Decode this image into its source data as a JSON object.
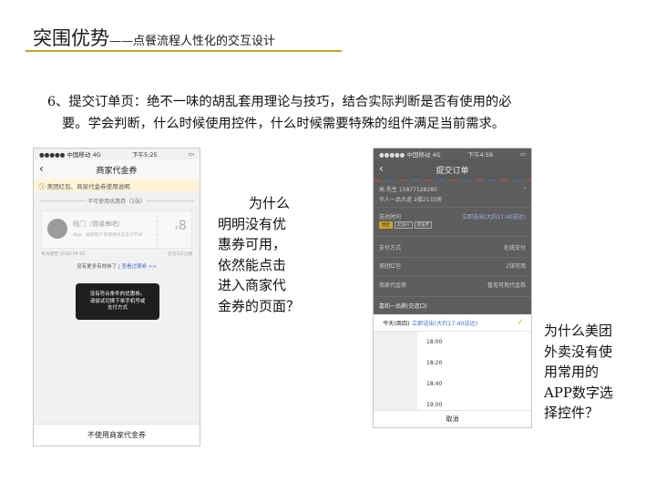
{
  "slide": {
    "title_main": "突围优势",
    "title_sub": "——点餐流程人性化的交互设计",
    "accent_color": "#c9a227",
    "paragraph_line1": "6、提交订单页：绝不一味的胡乱套用理论与技巧，结合实际判断是否有使用的必",
    "paragraph_line2": "要。学会判断，什么时候使用控件，什么时候需要特殊的组件满足当前需求。"
  },
  "phone1": {
    "status_left": "●●●●● 中国移动  4G",
    "status_time": "下午5:25",
    "status_right": "▭",
    "back_icon": "chevron-left-icon",
    "nav_title": "商家代金券",
    "notice": "ⓘ 美团红包、商家代金券使用说明",
    "section_header": "不可使用优惠券（1张）",
    "coupon": {
      "name": "贱门（情缘串吧）",
      "desc": "App、编辑现下单使用点击支付节单",
      "currency": "¥",
      "amount": "8",
      "date_left": "有效期至 2016-04-02",
      "date_right": "还有1天过期"
    },
    "no_more_text": "没有更多有效券了",
    "no_more_link": "查看过期券 >>",
    "toast_line1": "没有符合条件的优惠券。",
    "toast_line2": "请尝试切换下单手机号或",
    "toast_line3": "支付方式",
    "bottom_button": "不使用商家代金券"
  },
  "phone2": {
    "status_left": "●●●●● 中国移动  4G",
    "status_time": "下午4:58",
    "nav_title": "提交订单",
    "address_name": "高 先生     15877128280",
    "address_line": "华人一品大道 2楼2133房",
    "delivery_label": "送达时间",
    "delivery_value": "立即送出(大约17:40送达)",
    "tag1": "预定",
    "tag2": "起送价",
    "tag3": "配送费",
    "pay_label": "支付方式",
    "pay_value": "在线支付",
    "redpack_label": "美团红包",
    "redpack_value": "2张可用",
    "coupon_label": "商家代金券",
    "coupon_value": "暂无可用代金券",
    "shop_label": "嘉和一品粥(交道口)",
    "picker_day": "今天(周四)",
    "picker_now": "立即送出(大约17:40送达)",
    "check_icon": "checkmark-icon",
    "times": [
      "18:00",
      "18:20",
      "18:40",
      "19:00"
    ],
    "cancel": "取消"
  },
  "callout1": [
    "为什么",
    "明明没有优",
    "惠券可用，",
    "依然能点击",
    "进入商家代",
    "金券的页面？"
  ],
  "callout2": [
    "为什么美团",
    "外卖没有使",
    "用常用的",
    "APP数字选",
    "择控件？"
  ]
}
